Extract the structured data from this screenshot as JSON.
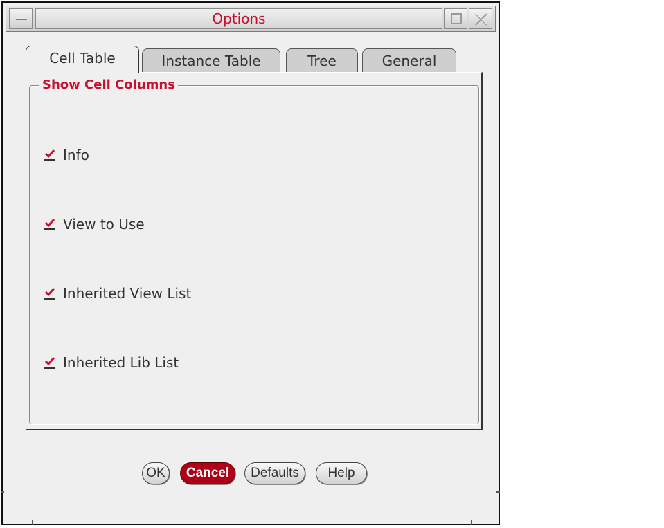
{
  "window": {
    "title": "Options",
    "menu_icon": "window-menu-icon",
    "maximize_icon": "maximize-icon",
    "close_icon": "close-icon"
  },
  "tabs": [
    {
      "label": "Cell Table",
      "active": true
    },
    {
      "label": "Instance Table",
      "active": false
    },
    {
      "label": "Tree",
      "active": false
    },
    {
      "label": "General",
      "active": false
    }
  ],
  "group": {
    "title": "Show Cell Columns",
    "items": [
      {
        "label": "Info",
        "checked": true
      },
      {
        "label": "View to Use",
        "checked": true
      },
      {
        "label": "Inherited View List",
        "checked": true
      },
      {
        "label": "Inherited Lib List",
        "checked": true
      }
    ]
  },
  "buttons": {
    "ok": "OK",
    "cancel": "Cancel",
    "defaults": "Defaults",
    "help": "Help"
  },
  "colors": {
    "accent_red": "#c8102e",
    "primary_button": "#b00018",
    "background": "#efefef"
  }
}
